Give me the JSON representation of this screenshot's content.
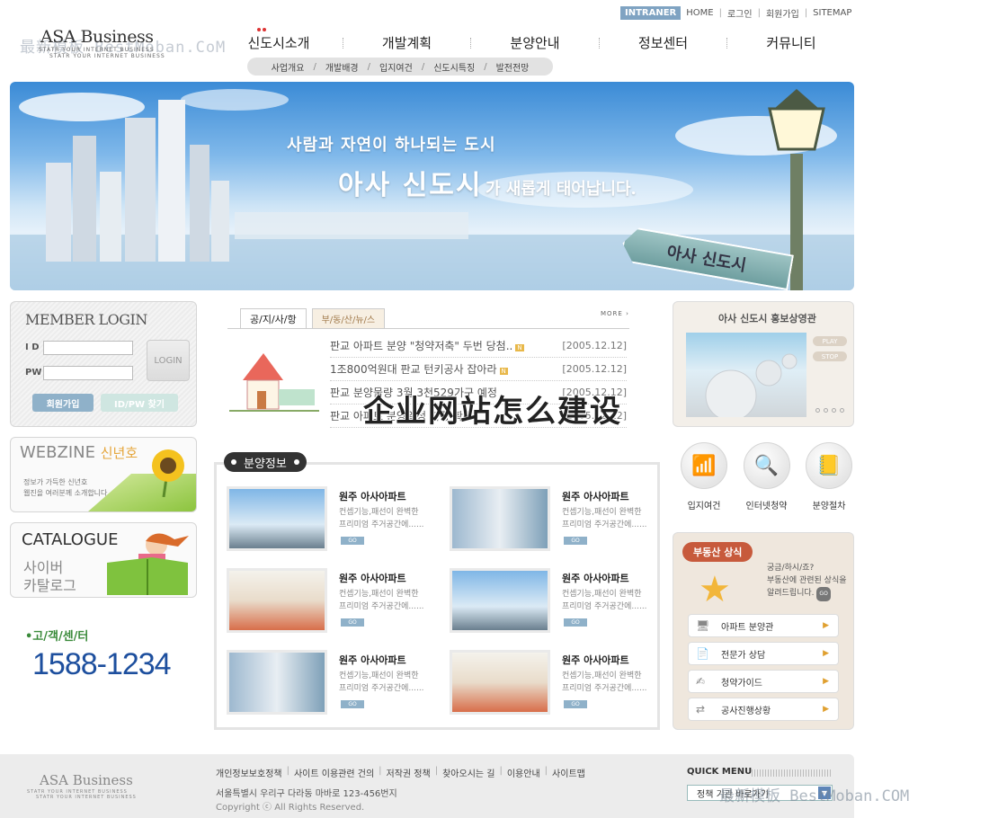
{
  "watermark": {
    "top": "最新模板 BestMoban.CoM",
    "bottom": "最新模板 BestMoban.COM"
  },
  "util": {
    "intraner": "INTRANER",
    "home": "HOME",
    "login": "로그인",
    "join": "회원가입",
    "sitemap": "SITEMAP"
  },
  "logo": {
    "name": "ASA Business",
    "tag1": "STATR YOUR INTERNET BUSINESS",
    "tag2": "STATR YOUR INTERNET BUSINESS"
  },
  "nav": {
    "items": [
      "신도시소개",
      "개발계획",
      "분양안내",
      "정보센터",
      "커뮤니티"
    ],
    "sub": [
      "사업개요",
      "개발배경",
      "입지여건",
      "신도시특징",
      "발전전망"
    ]
  },
  "banner": {
    "line1": "사람과 자연이 하나되는 도시",
    "line2_big": "아사 신도시",
    "line2_small": "가 새롭게 태어납니다.",
    "sign": "아사 신도시"
  },
  "login": {
    "title": "MEMBER LOGIN",
    "id_label": "I D",
    "pw_label": "PW",
    "login_btn": "LOGIN",
    "join_btn": "회원가입",
    "find_btn": "ID/PW 찾기"
  },
  "webzine": {
    "title": "WEBZINE",
    "badge": "신년호",
    "desc1": "정보가 가득한 신년호",
    "desc2": "웹진을 여러분께 소개합니다."
  },
  "catalogue": {
    "title": "CATALOGUE",
    "sub1": "사이버",
    "sub2": "카탈로그"
  },
  "cs": {
    "label": "•고/객/센/터",
    "phone": "1588-1234"
  },
  "notice": {
    "tab1": "공/지/사/항",
    "tab2": "부/동/산/뉴/스",
    "more": "MORE",
    "rows": [
      {
        "title": "판교 아파트 분양 \"청약저축\" 두번 당첨..",
        "date": "[2005.12.12]"
      },
      {
        "title": "1조800억원대 판교 턴키공사 잡아라",
        "date": "[2005.12.12]"
      },
      {
        "title": "판교 분양물량 3월 3천529가구 예정",
        "date": "[2005.12.12]"
      },
      {
        "title": "판교 아파트 분양일정 최종 확정",
        "date": "[2005.12.12]"
      }
    ],
    "overlay": "企业网站怎么建设"
  },
  "bunyang": {
    "title": "분양정보",
    "products": [
      {
        "name": "원주 아사아파트",
        "desc1": "컨셉기능,패선이 완벽한",
        "desc2": "프리미엄 주거공간에......",
        "go": "GO"
      },
      {
        "name": "원주 아사아파트",
        "desc1": "컨셉기능,패선이 완벽한",
        "desc2": "프리미엄 주거공간에......",
        "go": "GO"
      },
      {
        "name": "원주 아사아파트",
        "desc1": "컨셉기능,패선이 완벽한",
        "desc2": "프리미엄 주거공간에......",
        "go": "GO"
      },
      {
        "name": "원주 아사아파트",
        "desc1": "컨셉기능,패선이 완벽한",
        "desc2": "프리미엄 주거공간에......",
        "go": "GO"
      },
      {
        "name": "원주 아사아파트",
        "desc1": "컨셉기능,패선이 완벽한",
        "desc2": "프리미엄 주거공간에......",
        "go": "GO"
      },
      {
        "name": "원주 아사아파트",
        "desc1": "컨셉기능,패선이 완벽한",
        "desc2": "프리미엄 주거공간에......",
        "go": "GO"
      }
    ]
  },
  "pr": {
    "title": "아사 신도시 홍보상영관",
    "play": "PLAY",
    "stop": "STOP"
  },
  "quick": {
    "items": [
      "입지여건",
      "인터넷청약",
      "분양절차"
    ]
  },
  "sangsik": {
    "badge": "부동산 상식",
    "q": "궁금/하시/죠?",
    "t1": "부동산에 관련된 상식을",
    "t2": "알려드립니다.",
    "go": "GO",
    "menu": [
      "아파트 분양관",
      "전문가 상담",
      "청약가이드",
      "공사진행상황"
    ]
  },
  "footer": {
    "logo": "ASA Business",
    "tag1": "STATR YOUR INTERNET BUSINESS",
    "tag2": "STATR YOUR INTERNET BUSINESS",
    "links": [
      "개인정보보호정책",
      "사이트 이용관련 건의",
      "저작권 정책",
      "찾아오시는 길",
      "이용안내",
      "사이트맵"
    ],
    "address": "서울특별시 우리구 다라동 마바로 123-456번지",
    "copyright": "Copyright ⓒ All Rights Reserved.",
    "quick_menu": "QUICK MENU",
    "select_value": "정책 기관 바로가기"
  },
  "colors": {
    "accent": "#8fb1c9",
    "phone": "#1d4f9e",
    "badge": "#c75a3c"
  }
}
